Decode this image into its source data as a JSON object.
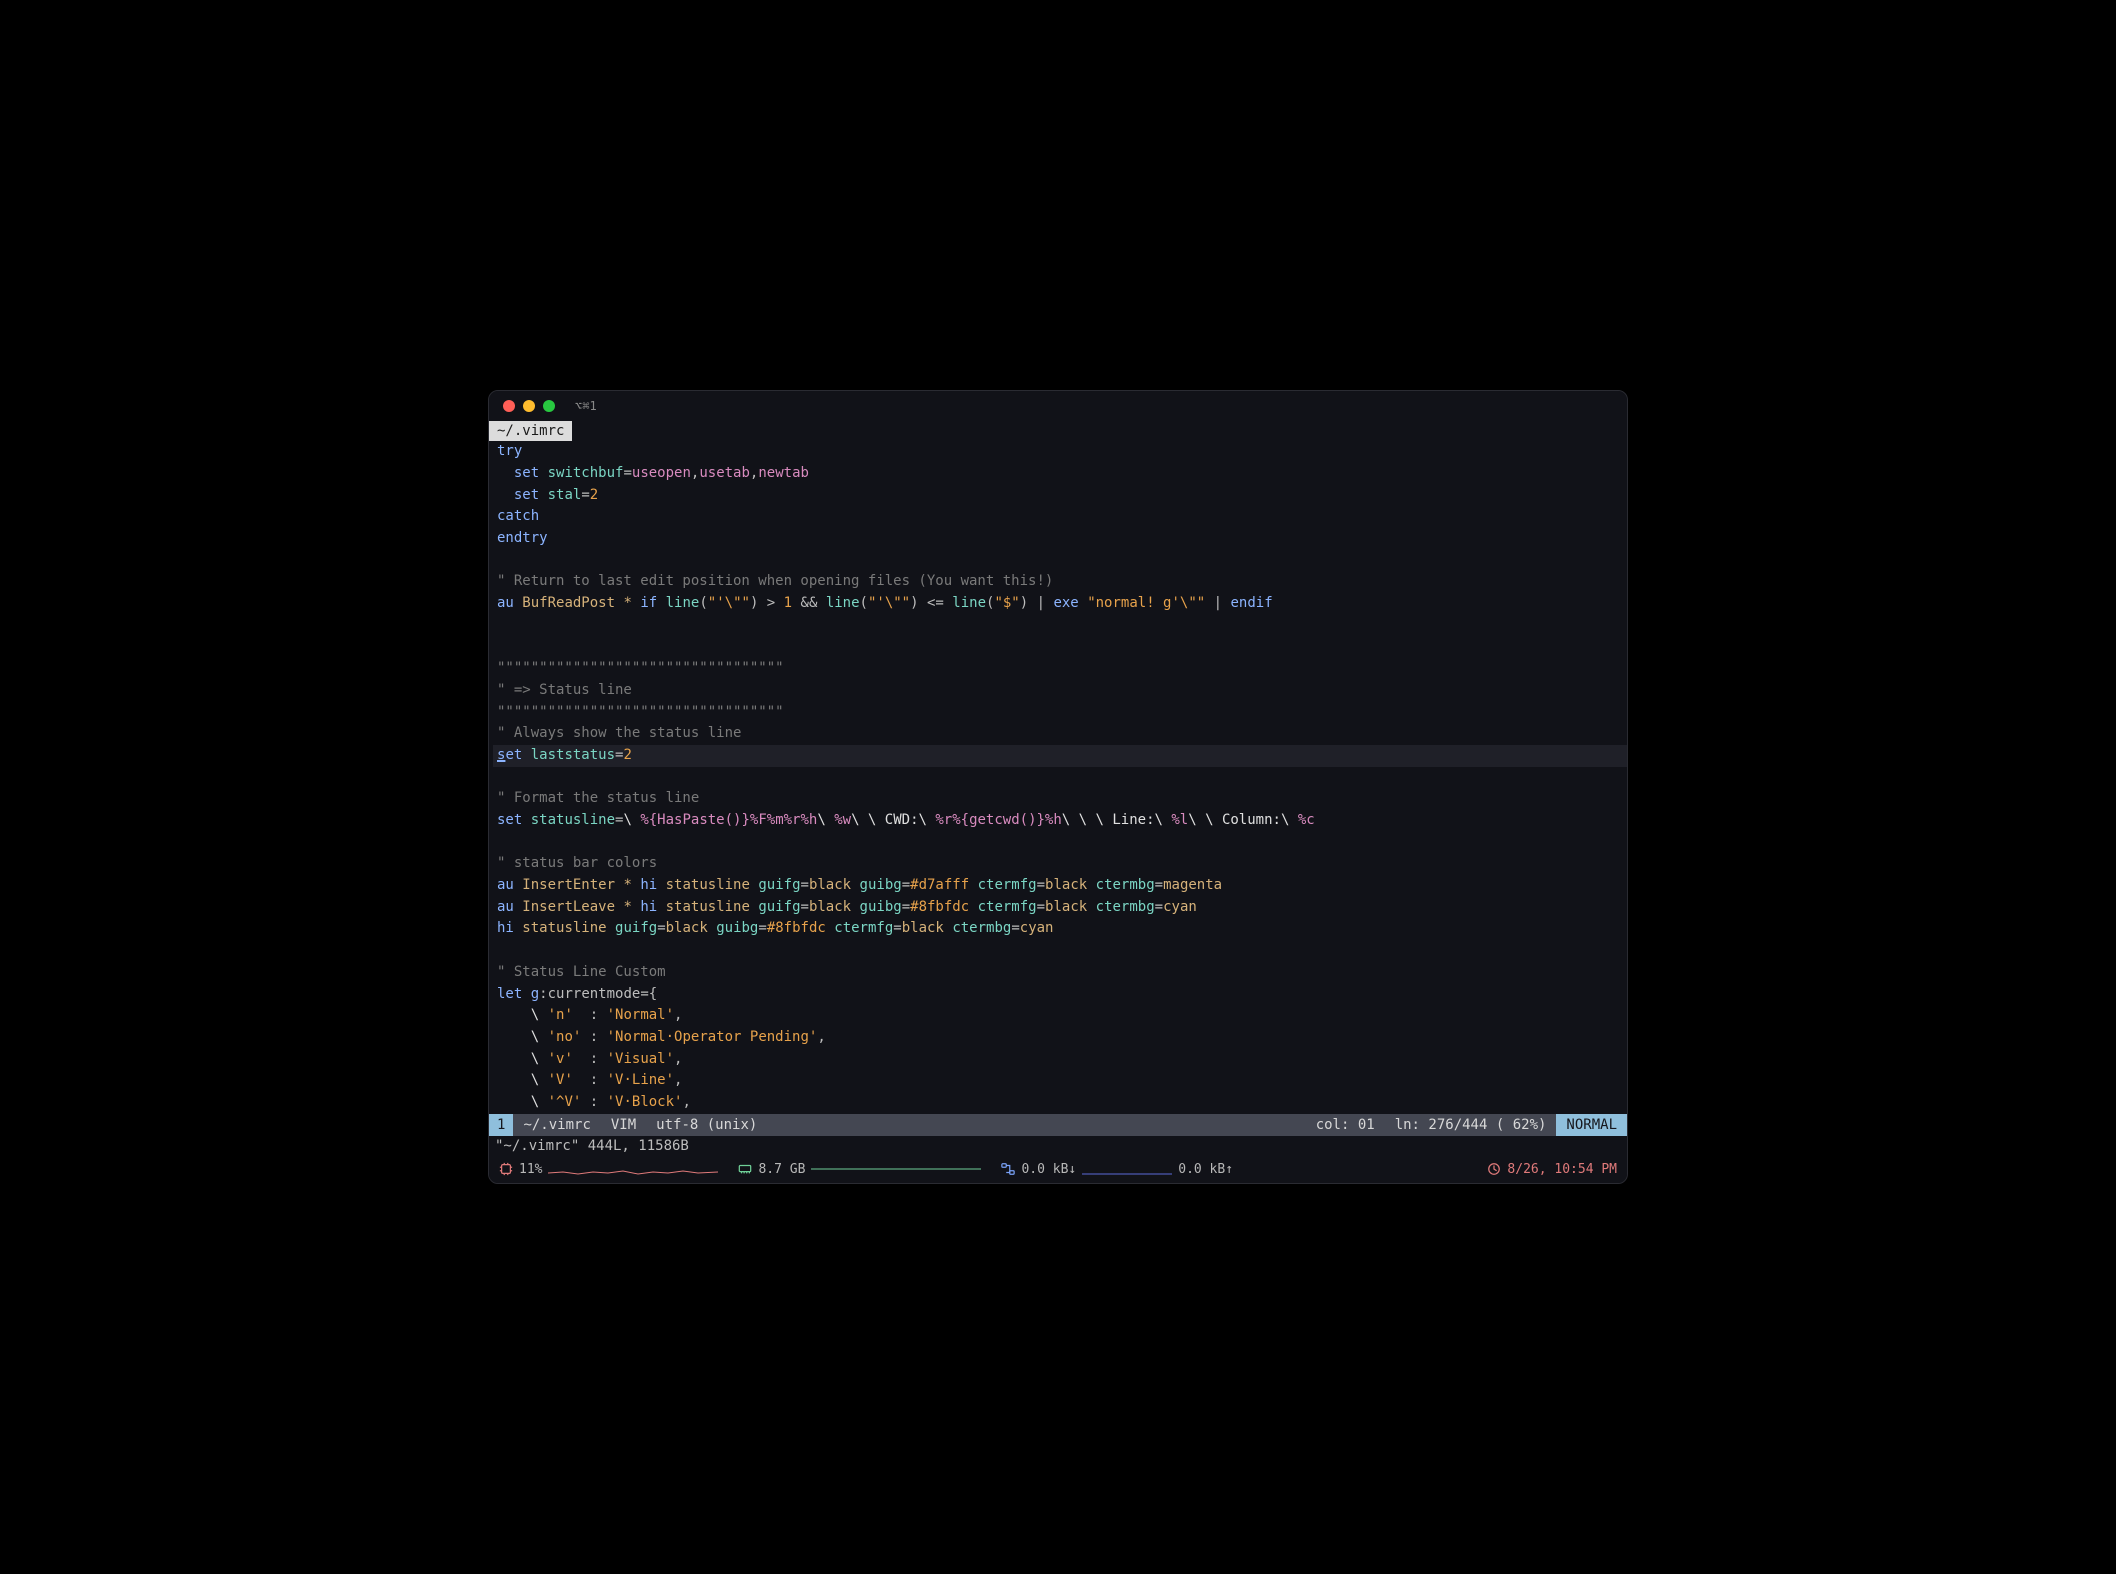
{
  "window": {
    "title": "⌥⌘1"
  },
  "tab": {
    "label": "~/.vimrc"
  },
  "code_lines": [
    {
      "html": "<span class='c-key'>try</span>"
    },
    {
      "html": "  <span class='c-key'>set</span> <span class='c-stmt'>switchbuf</span><span class='c-eq'>=</span><span class='c-pink'>useopen</span>,<span class='c-pink'>usetab</span>,<span class='c-pink'>newtab</span>"
    },
    {
      "html": "  <span class='c-key'>set</span> <span class='c-stmt'>stal</span><span class='c-eq'>=</span><span class='c-num'>2</span>"
    },
    {
      "html": "<span class='c-key'>catch</span>"
    },
    {
      "html": "<span class='c-key'>endtry</span>"
    },
    {
      "html": ""
    },
    {
      "html": "<span class='c-comment'>\" Return to last edit position when opening files (You want this!)</span>"
    },
    {
      "html": "<span class='c-key'>au</span> <span class='c-ident'>BufReadPost</span> <span class='c-ident'>*</span> <span class='c-key'>if</span> <span class='c-stmt'>line</span>(<span class='c-str'>\"'\\\"\"</span>) &gt; <span class='c-num'>1</span> &amp;&amp; <span class='c-stmt'>line</span>(<span class='c-str'>\"'\\\"\"</span>) &lt;= <span class='c-stmt'>line</span>(<span class='c-str'>\"$\"</span>) | <span class='c-key'>exe</span> <span class='c-str'>\"normal! g'\\\"\"</span> | <span class='c-key'>endif</span>"
    },
    {
      "html": ""
    },
    {
      "html": ""
    },
    {
      "html": "<span class='c-comment'>\"\"\"\"\"\"\"\"\"\"\"\"\"\"\"\"\"\"\"\"\"\"\"\"\"\"\"\"\"\"\"\"\"\"</span>"
    },
    {
      "html": "<span class='c-comment'>\" =&gt; Status line</span>"
    },
    {
      "html": "<span class='c-comment'>\"\"\"\"\"\"\"\"\"\"\"\"\"\"\"\"\"\"\"\"\"\"\"\"\"\"\"\"\"\"\"\"\"\"</span>"
    },
    {
      "html": "<span class='c-comment'>\" Always show the status line</span>"
    },
    {
      "html": "<span class='c-key'><span class='cursor-underline'>s</span>et</span> <span class='c-stmt'>laststatus</span><span class='c-eq'>=</span><span class='c-num'>2</span>",
      "cursor": true
    },
    {
      "html": ""
    },
    {
      "html": "<span class='c-comment'>\" Format the status line</span>"
    },
    {
      "html": "<span class='c-key'>set</span> <span class='c-stmt'>statusline</span><span class='c-eq'>=</span><span class='c-white'>\\ </span><span class='c-pink'>%{HasPaste()}</span><span class='c-pink'>%F%m%r%h</span><span class='c-white'>\\ </span><span class='c-pink'>%w</span><span class='c-white'>\\ \\ CWD:\\ </span><span class='c-pink'>%r%{getcwd()}%h</span><span class='c-white'>\\ \\ \\ Line:\\ </span><span class='c-pink'>%l</span><span class='c-white'>\\ \\ Column:\\ </span><span class='c-pink'>%c</span>"
    },
    {
      "html": ""
    },
    {
      "html": "<span class='c-comment'>\" status bar colors</span>"
    },
    {
      "html": "<span class='c-key'>au</span> <span class='c-ident'>InsertEnter</span> <span class='c-ident'>*</span> <span class='c-key'>hi</span> <span class='c-ident'>statusline</span> <span class='c-stmt'>guifg</span>=<span class='c-ident'>black</span> <span class='c-stmt'>guibg</span>=<span class='c-hex'>#d7afff</span> <span class='c-stmt'>ctermfg</span>=<span class='c-ident'>black</span> <span class='c-stmt'>ctermbg</span>=<span class='c-ident'>magenta</span>"
    },
    {
      "html": "<span class='c-key'>au</span> <span class='c-ident'>InsertLeave</span> <span class='c-ident'>*</span> <span class='c-key'>hi</span> <span class='c-ident'>statusline</span> <span class='c-stmt'>guifg</span>=<span class='c-ident'>black</span> <span class='c-stmt'>guibg</span>=<span class='c-hex'>#8fbfdc</span> <span class='c-stmt'>ctermfg</span>=<span class='c-ident'>black</span> <span class='c-stmt'>ctermbg</span>=<span class='c-ident'>cyan</span>"
    },
    {
      "html": "<span class='c-key'>hi</span> <span class='c-ident'>statusline</span> <span class='c-stmt'>guifg</span>=<span class='c-ident'>black</span> <span class='c-stmt'>guibg</span>=<span class='c-hex'>#8fbfdc</span> <span class='c-stmt'>ctermfg</span>=<span class='c-ident'>black</span> <span class='c-stmt'>ctermbg</span>=<span class='c-ident'>cyan</span>"
    },
    {
      "html": ""
    },
    {
      "html": "<span class='c-comment'>\" Status Line Custom</span>"
    },
    {
      "html": "<span class='c-key'>let</span> <span class='c-var'>g</span>:currentmode<span class='c-eq'>=</span>{"
    },
    {
      "html": "    <span class='c-white'>\\</span> <span class='c-str'>'n'</span>  : <span class='c-str'>'Normal'</span>,"
    },
    {
      "html": "    <span class='c-white'>\\</span> <span class='c-str'>'no'</span> : <span class='c-str'>'Normal·Operator Pending'</span>,"
    },
    {
      "html": "    <span class='c-white'>\\</span> <span class='c-str'>'v'</span>  : <span class='c-str'>'Visual'</span>,"
    },
    {
      "html": "    <span class='c-white'>\\</span> <span class='c-str'>'V'</span>  : <span class='c-str'>'V·Line'</span>,"
    },
    {
      "html": "    <span class='c-white'>\\</span> <span class='c-str'>'^V'</span> : <span class='c-str'>'V·Block'</span>,"
    }
  ],
  "statusline": {
    "bufnum": "1",
    "file": "~/.vimrc",
    "filetype": "VIM",
    "encoding": "utf-8 (unix)",
    "col": "col: 01",
    "line": "ln: 276/444 ( 62%)",
    "mode": "NORMAL"
  },
  "cmdline": "\"~/.vimrc\" 444L, 11586B",
  "bottombar": {
    "cpu_pct": "11%",
    "mem": "8.7 GB",
    "net_down": "0.0 kB↓",
    "net_up": "0.0 kB↑",
    "clock": "8/26, 10:54 PM"
  },
  "colors": {
    "accent_cyan": "#8fbfdc",
    "accent_pink": "#d7afff",
    "red": "#e07a7a"
  }
}
